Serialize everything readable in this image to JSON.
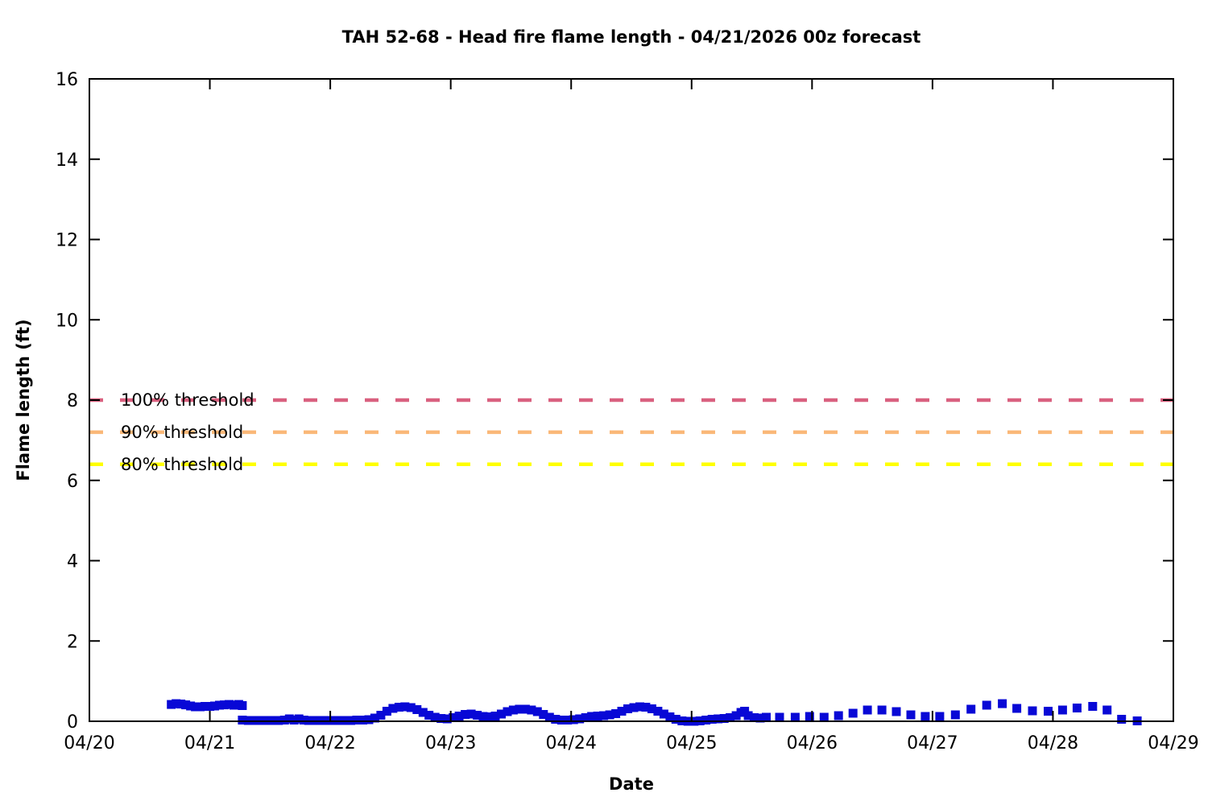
{
  "window": {
    "background": "#ffffff",
    "foreground": "#000000"
  },
  "chart_data": {
    "type": "line",
    "title": "TAH 52-68 - Head fire flame length - 04/21/2026 00z forecast",
    "xlabel": "Date",
    "ylabel": "Flame length (ft)",
    "x_tick_labels": [
      "04/20",
      "04/21",
      "04/22",
      "04/23",
      "04/24",
      "04/25",
      "04/26",
      "04/27",
      "04/28",
      "04/29"
    ],
    "x_range_days": [
      0,
      9
    ],
    "ylim": [
      0,
      16
    ],
    "y_ticks": [
      0,
      2,
      4,
      6,
      8,
      10,
      12,
      14,
      16
    ],
    "grid": false,
    "legend_position": "inline-upper-left",
    "thresholds": [
      {
        "label": "100% threshold",
        "value": 8,
        "color": "#d9607f",
        "style": "dashed"
      },
      {
        "label": "90% threshold",
        "value": 7.2,
        "color": "#fab878",
        "style": "dashed"
      },
      {
        "label": "80% threshold",
        "value": 6.4,
        "color": "#ffff00",
        "style": "dashed"
      }
    ],
    "series": {
      "color": "#0808d6",
      "marker": "square",
      "y_units": "ft",
      "x_units": "days_after_04_20_00z",
      "dense_segments": [
        [
          [
            0.68,
            0.42
          ],
          [
            0.72,
            0.44
          ],
          [
            0.76,
            0.43
          ],
          [
            0.8,
            0.41
          ],
          [
            0.84,
            0.38
          ],
          [
            0.88,
            0.36
          ],
          [
            0.92,
            0.36
          ],
          [
            0.96,
            0.37
          ],
          [
            1.0,
            0.37
          ],
          [
            1.04,
            0.38
          ],
          [
            1.08,
            0.4
          ],
          [
            1.12,
            0.41
          ],
          [
            1.16,
            0.42
          ],
          [
            1.2,
            0.4
          ],
          [
            1.24,
            0.42
          ],
          [
            1.27,
            0.39
          ]
        ],
        [
          [
            1.27,
            0.03
          ],
          [
            1.32,
            0.02
          ],
          [
            1.37,
            0.02
          ],
          [
            1.42,
            0.02
          ],
          [
            1.47,
            0.02
          ],
          [
            1.52,
            0.02
          ],
          [
            1.57,
            0.02
          ],
          [
            1.62,
            0.03
          ],
          [
            1.66,
            0.06
          ],
          [
            1.7,
            0.03
          ],
          [
            1.74,
            0.06
          ],
          [
            1.78,
            0.03
          ],
          [
            1.82,
            0.02
          ],
          [
            1.87,
            0.02
          ],
          [
            1.92,
            0.02
          ],
          [
            1.97,
            0.02
          ],
          [
            2.02,
            0.02
          ],
          [
            2.07,
            0.02
          ],
          [
            2.12,
            0.02
          ],
          [
            2.17,
            0.02
          ],
          [
            2.22,
            0.03
          ],
          [
            2.27,
            0.03
          ],
          [
            2.32,
            0.04
          ],
          [
            2.37,
            0.08
          ],
          [
            2.42,
            0.15
          ],
          [
            2.47,
            0.25
          ],
          [
            2.52,
            0.32
          ],
          [
            2.57,
            0.35
          ],
          [
            2.62,
            0.36
          ],
          [
            2.67,
            0.34
          ],
          [
            2.72,
            0.29
          ],
          [
            2.77,
            0.22
          ],
          [
            2.82,
            0.15
          ],
          [
            2.87,
            0.1
          ],
          [
            2.92,
            0.07
          ],
          [
            2.97,
            0.06
          ],
          [
            3.02,
            0.09
          ],
          [
            3.07,
            0.13
          ],
          [
            3.12,
            0.17
          ],
          [
            3.17,
            0.18
          ],
          [
            3.22,
            0.15
          ],
          [
            3.27,
            0.12
          ],
          [
            3.32,
            0.11
          ],
          [
            3.37,
            0.13
          ],
          [
            3.42,
            0.18
          ],
          [
            3.47,
            0.24
          ],
          [
            3.52,
            0.28
          ],
          [
            3.57,
            0.3
          ],
          [
            3.62,
            0.3
          ],
          [
            3.67,
            0.28
          ],
          [
            3.72,
            0.24
          ],
          [
            3.77,
            0.17
          ],
          [
            3.82,
            0.1
          ],
          [
            3.87,
            0.05
          ],
          [
            3.92,
            0.03
          ],
          [
            3.97,
            0.03
          ],
          [
            4.02,
            0.04
          ],
          [
            4.07,
            0.06
          ],
          [
            4.12,
            0.09
          ],
          [
            4.17,
            0.12
          ],
          [
            4.22,
            0.13
          ],
          [
            4.27,
            0.14
          ],
          [
            4.32,
            0.16
          ],
          [
            4.37,
            0.19
          ],
          [
            4.42,
            0.25
          ],
          [
            4.47,
            0.31
          ],
          [
            4.52,
            0.34
          ],
          [
            4.57,
            0.36
          ],
          [
            4.62,
            0.35
          ],
          [
            4.67,
            0.31
          ],
          [
            4.72,
            0.25
          ],
          [
            4.77,
            0.18
          ],
          [
            4.82,
            0.11
          ],
          [
            4.87,
            0.05
          ],
          [
            4.92,
            0.01
          ],
          [
            4.97,
            0.0
          ],
          [
            5.02,
            0.0
          ],
          [
            5.07,
            0.01
          ],
          [
            5.12,
            0.03
          ],
          [
            5.17,
            0.05
          ],
          [
            5.22,
            0.06
          ],
          [
            5.27,
            0.07
          ],
          [
            5.32,
            0.09
          ],
          [
            5.37,
            0.14
          ],
          [
            5.41,
            0.22
          ],
          [
            5.44,
            0.25
          ],
          [
            5.47,
            0.14
          ],
          [
            5.52,
            0.09
          ],
          [
            5.57,
            0.08
          ],
          [
            5.62,
            0.1
          ]
        ]
      ],
      "sparse_points": [
        [
          5.73,
          0.1
        ],
        [
          5.86,
          0.1
        ],
        [
          5.98,
          0.12
        ],
        [
          6.1,
          0.1
        ],
        [
          6.22,
          0.14
        ],
        [
          6.34,
          0.2
        ],
        [
          6.46,
          0.28
        ],
        [
          6.58,
          0.28
        ],
        [
          6.7,
          0.24
        ],
        [
          6.82,
          0.16
        ],
        [
          6.94,
          0.12
        ],
        [
          7.06,
          0.12
        ],
        [
          7.19,
          0.16
        ],
        [
          7.32,
          0.3
        ],
        [
          7.45,
          0.4
        ],
        [
          7.58,
          0.44
        ],
        [
          7.7,
          0.32
        ],
        [
          7.83,
          0.26
        ],
        [
          7.96,
          0.25
        ],
        [
          8.08,
          0.28
        ],
        [
          8.2,
          0.33
        ],
        [
          8.33,
          0.37
        ],
        [
          8.45,
          0.28
        ],
        [
          8.57,
          0.05
        ],
        [
          8.7,
          0.01
        ]
      ]
    }
  }
}
